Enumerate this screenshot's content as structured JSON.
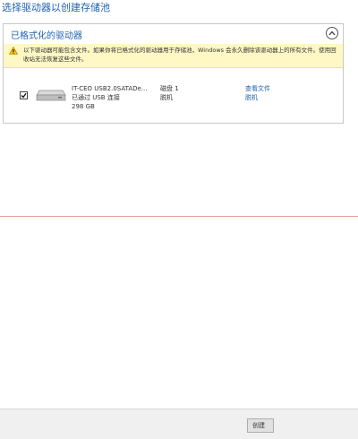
{
  "page": {
    "title": "选择驱动器以创建存储池"
  },
  "panel": {
    "title": "已格式化的驱动器",
    "warning": "以下驱动器可能包含文件。如果你将已格式化的驱动器用于存储池，Windows 会永久删除该驱动器上的所有文件。使用回收站无法恢复这些文件。"
  },
  "drive": {
    "name": "IT-CEO USB2.0SATADe...",
    "connection": "已通过 USB 连接",
    "size": "298 GB",
    "disk": "磁盘 1",
    "status": "脱机",
    "view_files_link": "查看文件",
    "offline_link": "脱机",
    "checked": true
  },
  "footer": {
    "create_label": "创建"
  }
}
